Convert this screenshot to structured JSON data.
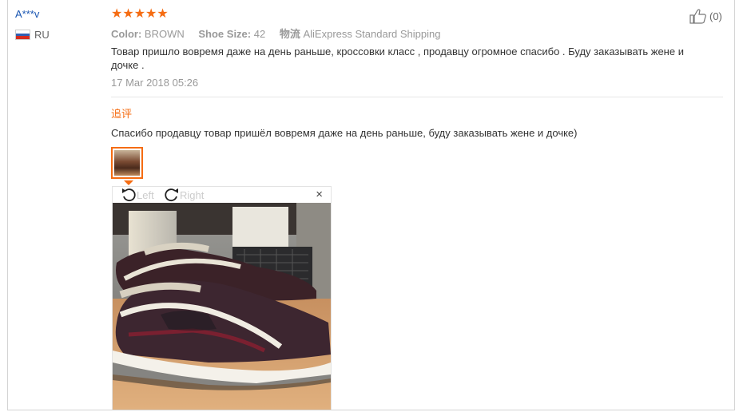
{
  "reviewer": {
    "name": "A***v",
    "country": "RU",
    "flag_colors": [
      "#ffffff",
      "#2f5fb3",
      "#d52b1e"
    ]
  },
  "rating": {
    "stars": 5,
    "star_color": "#f56c12",
    "star_glyph": "★"
  },
  "order_info": {
    "color_label": "Color:",
    "color_value": "BROWN",
    "size_label": "Shoe Size:",
    "size_value": "42",
    "logistics_label": "物流",
    "logistics_value": "AliExpress Standard Shipping"
  },
  "feedback": {
    "text": "Товар пришло вовремя даже на день раньше, кроссовки класс , продавцу огромное спасибо . Буду заказывать жене и дочке .",
    "date": "17 Mar 2018 05:26"
  },
  "additional_feedback": {
    "label": "追评",
    "text": "Спасибо продавцу товар пришёл вовремя даже на день раньше, буду заказывать жене и дочке)"
  },
  "image_viewer": {
    "rotate_left_label": "Left",
    "rotate_right_label": "Right",
    "close_glyph": "×",
    "rotate_left_icon": "rotate-left-icon",
    "rotate_right_icon": "rotate-right-icon"
  },
  "helpful": {
    "count": "(0)",
    "icon": "thumbs-up-icon"
  }
}
